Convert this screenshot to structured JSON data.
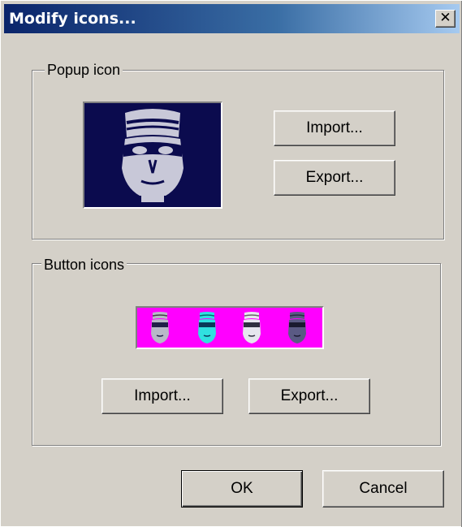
{
  "window": {
    "title": "Modify icons...",
    "close_symbol": "✕",
    "close_icon": "close-icon"
  },
  "popup_group": {
    "label": "Popup icon",
    "preview_icon": "masked-robber-icon",
    "preview_bg": "#0b0b4e",
    "import_label": "Import...",
    "export_label": "Export..."
  },
  "button_group": {
    "label": "Button icons",
    "strip_bg": "#ff00ff",
    "icons": [
      {
        "icon": "masked-robber-gray-icon",
        "color": "#b8b8c8"
      },
      {
        "icon": "masked-robber-cyan-icon",
        "color": "#30e0e0"
      },
      {
        "icon": "masked-robber-white-icon",
        "color": "#e6e6ee"
      },
      {
        "icon": "masked-robber-dark-icon",
        "color": "#5a5a84"
      }
    ],
    "import_label": "Import...",
    "export_label": "Export..."
  },
  "footer": {
    "ok_label": "OK",
    "cancel_label": "Cancel"
  }
}
